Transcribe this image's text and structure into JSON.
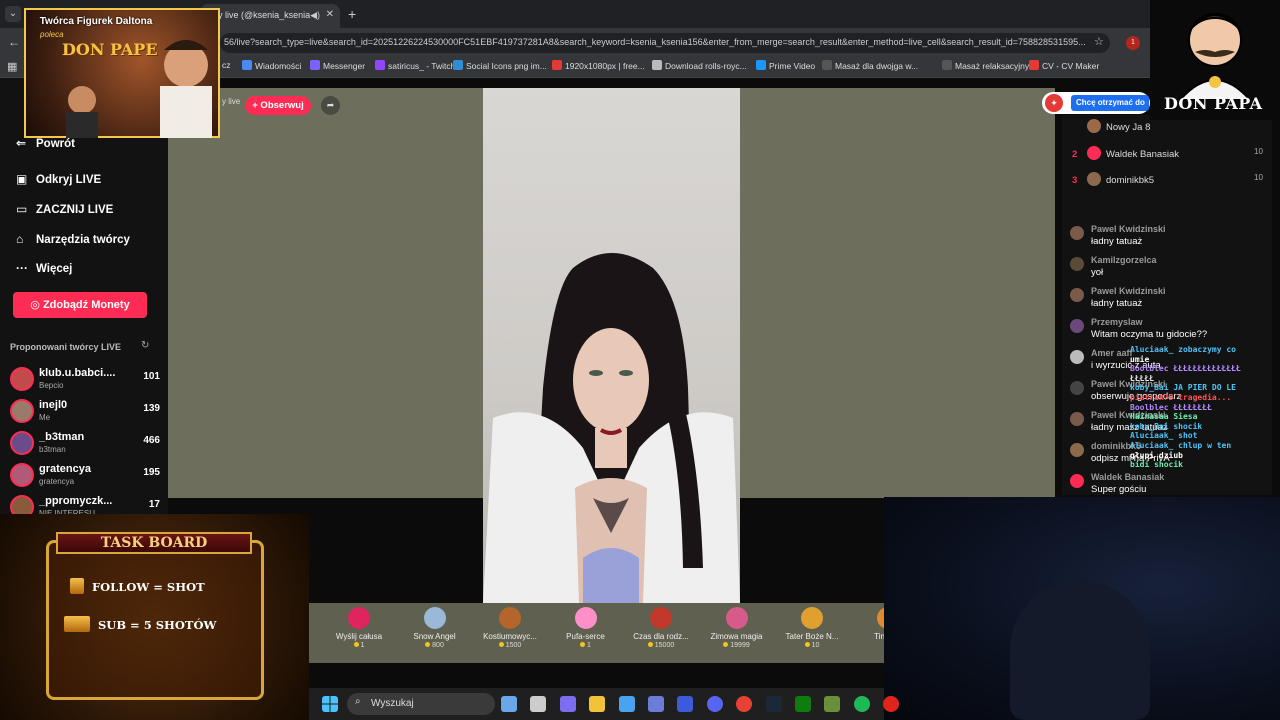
{
  "browser": {
    "tab_title": "y live (@ksenia_ksenia",
    "url": "56/live?search_type=live&search_id=20251226224530000FC51EBF419737281A8&search_keyword=ksenia_ksenia156&enter_from_merge=search_result&enter_method=live_cell&search_result_id=758828531595...",
    "extension_badge": "1",
    "bookmarks": [
      {
        "label": "Wiadomości",
        "color": "#4a8af4"
      },
      {
        "label": "Messenger",
        "color": "#7b61ff"
      },
      {
        "label": "satiricus_ - Twitch",
        "color": "#9146ff"
      },
      {
        "label": "Social Icons png im...",
        "color": "#2f8dd6"
      },
      {
        "label": "1920x1080px | free...",
        "color": "#e53935"
      },
      {
        "label": "Download rolls-royc...",
        "color": "#bbbbbb"
      },
      {
        "label": "Prime Video",
        "color": "#1a98ff"
      },
      {
        "label": "Masaż dla dwojga w...",
        "color": "#555555"
      },
      {
        "label": "Masaż relaksacyjny...",
        "color": "#555555"
      },
      {
        "label": "CV - CV Maker",
        "color": "#e53935"
      }
    ],
    "bookmark_prefix": "cz"
  },
  "sidebar": {
    "back_label": "Powrót",
    "items": [
      {
        "label": "Odkryj LIVE",
        "icon": "▣"
      },
      {
        "label": "ZACZNIJ LIVE",
        "icon": "▭"
      },
      {
        "label": "Narzędzia twórcy",
        "icon": "⌂"
      },
      {
        "label": "Więcej",
        "icon": "···"
      }
    ],
    "coins_button": "Zdobądź Monety",
    "suggested_title": "Proponowani twórcy LIVE",
    "creators": [
      {
        "name": "klub.u.babci....",
        "sub": "Bepcio",
        "count": "101",
        "color": "#c24a4a"
      },
      {
        "name": "inejl0",
        "sub": "Me",
        "count": "139",
        "color": "#9a7b6a"
      },
      {
        "name": "_b3tman",
        "sub": "b3tman",
        "count": "466",
        "color": "#6b4b8a"
      },
      {
        "name": "gratencya",
        "sub": "gratencya",
        "count": "195",
        "color": "#b05a78"
      },
      {
        "name": "_ppromyczk...",
        "sub": "NIE INTERESU",
        "count": "17",
        "color": "#8a5a3a"
      }
    ]
  },
  "stream_header": {
    "host_label": "y live",
    "follow_button": "+ Obserwuj"
  },
  "gifts": [
    {
      "name": "Wyślij całusa",
      "price": "1",
      "color": "#e0245e"
    },
    {
      "name": "Snow Angel",
      "price": "800",
      "color": "#9ab8d8"
    },
    {
      "name": "Kostiumowyc...",
      "price": "1500",
      "color": "#b5652a"
    },
    {
      "name": "Pufa-serce",
      "price": "1",
      "color": "#ff8fc8"
    },
    {
      "name": "Czas dla rodz...",
      "price": "15000",
      "color": "#c0392b"
    },
    {
      "name": "Zimowa magia",
      "price": "19999",
      "color": "#d65a8a"
    },
    {
      "name": "Tater Boże N...",
      "price": "10",
      "color": "#e0a030"
    },
    {
      "name": "Tiny Bo",
      "price": "",
      "color": "#e08a30"
    }
  ],
  "right_panel": {
    "promo_text": "Chcę otrzymać do",
    "ranking": [
      {
        "rank": "",
        "name": "Nowy Ja 8",
        "points": "",
        "color": "#9a6a4a"
      },
      {
        "rank": "2",
        "name": "Waldek Banasiak",
        "points": "10",
        "color": "#fe2c55"
      },
      {
        "rank": "3",
        "name": "dominikbk5",
        "points": "10",
        "color": "#8a6a4a"
      }
    ],
    "messages": [
      {
        "user": "Pawel Kwidzinski",
        "text": "ładny tatuaż",
        "color": "#7a5a4a"
      },
      {
        "user": "Kamilzgorzelca",
        "text": "yoł",
        "color": "#5a4a3a"
      },
      {
        "user": "Pawel Kwidzinski",
        "text": "ładny tatuaż",
        "color": "#7a5a4a"
      },
      {
        "user": "Przemyslaw",
        "text": "Witam oczyma tu gidocie??",
        "color": "#6a4a7a"
      },
      {
        "user": "Amer aaff",
        "text": "i wyrzucić z auta",
        "color": "#bbbbbb"
      },
      {
        "user": "Pawel Kwidzinski",
        "text": "obserwuje gospodarz",
        "color": "#444444"
      },
      {
        "user": "Pawel Kwidzinski",
        "text": "ładny masz tatuaż",
        "color": "#7a5a4a"
      },
      {
        "user": "dominikbk5",
        "text": "odpisz mi na PrivA",
        "color": "#8a6a4a"
      },
      {
        "user": "Waldek Banasiak",
        "text": "Super gościu",
        "color": "#fe2c55"
      }
    ]
  },
  "overlay_chat": [
    {
      "text": "Aluciaak_  zobaczymy co",
      "color": "#4fc3f7"
    },
    {
      "text": "           umie",
      "color": "#ffffff"
    },
    {
      "text": "Boolblec  ŁŁŁŁŁŁŁŁŁŁŁŁŁŁ",
      "color": "#b388ff"
    },
    {
      "text": "          ŁŁŁŁŁ",
      "color": "#dddddd"
    },
    {
      "text": "koby_Bai   JA PIER DO LE",
      "color": "#4fc3f7"
    },
    {
      "text": "piatrak79  tragedia...",
      "color": "#ff5252"
    },
    {
      "text": "Boolblec   ŁŁŁŁŁŁŁŁ",
      "color": "#b388ff"
    },
    {
      "text": "Hainasaa   Siesa",
      "color": "#69f0ae"
    },
    {
      "text": "koby_Bai   shocik",
      "color": "#4fc3f7"
    },
    {
      "text": "Aluciaak_  shot",
      "color": "#4fc3f7"
    },
    {
      "text": "Aluciaak_  chlup w ten",
      "color": "#4fc3f7"
    },
    {
      "text": "           głupi dziub",
      "color": "#ffffff"
    },
    {
      "text": "bidi       shocik",
      "color": "#69f0ae"
    }
  ],
  "overlays": {
    "banner_title": "Twórca Figurek Daltona",
    "banner_sub": "poleca",
    "banner_logo": "DON PAPE",
    "corner_logo": "DON PAPA",
    "task_board_title": "TASK BOARD",
    "task_lines": [
      "FOLLOW = SHOT",
      "SUB = 5 SHOTÓW"
    ]
  },
  "taskbar": {
    "search_placeholder": "Wyszukaj",
    "apps": [
      {
        "name": "cloud-widget",
        "color": "#6aa7e8"
      },
      {
        "name": "task-view",
        "color": "#cccccc"
      },
      {
        "name": "copilot",
        "color": "#7c6cf0"
      },
      {
        "name": "file-explorer",
        "color": "#f3c23c"
      },
      {
        "name": "store",
        "color": "#4aa3f0"
      },
      {
        "name": "settings",
        "color": "#6b7bd8"
      },
      {
        "name": "l-app",
        "color": "#3b5bdb"
      },
      {
        "name": "discord",
        "color": "#5865f2"
      },
      {
        "name": "chrome",
        "color": "#e94235"
      },
      {
        "name": "steam",
        "color": "#1b2838"
      },
      {
        "name": "xbox",
        "color": "#107c10"
      },
      {
        "name": "minecraft",
        "color": "#6a8f3a"
      },
      {
        "name": "spotify",
        "color": "#1db954"
      },
      {
        "name": "opera",
        "color": "#e0261c"
      }
    ]
  }
}
